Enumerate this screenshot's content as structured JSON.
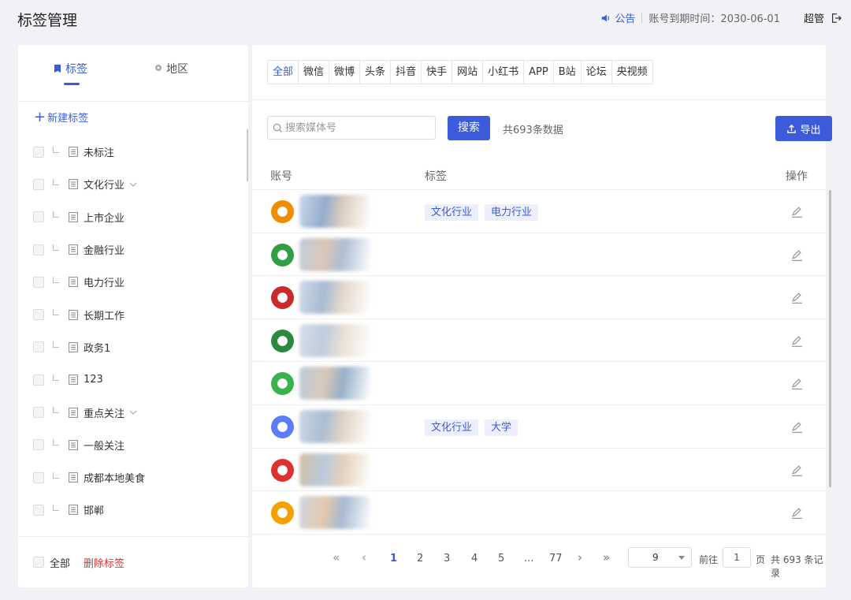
{
  "header": {
    "title": "标签管理",
    "notice": "公告",
    "expire": "账号到期时间：2030-06-01",
    "user": "超管"
  },
  "left": {
    "tabs": [
      {
        "label": "标签",
        "active": true
      },
      {
        "label": "地区",
        "active": false
      }
    ],
    "new_tag": "新建标签",
    "tags": [
      {
        "label": "未标注",
        "expandable": false
      },
      {
        "label": "文化行业",
        "expandable": true
      },
      {
        "label": "上市企业",
        "expandable": false
      },
      {
        "label": "金融行业",
        "expandable": false
      },
      {
        "label": "电力行业",
        "expandable": false
      },
      {
        "label": "长期工作",
        "expandable": false
      },
      {
        "label": "政务1",
        "expandable": false
      },
      {
        "label": "123",
        "expandable": false
      },
      {
        "label": "重点关注",
        "expandable": true
      },
      {
        "label": "一般关注",
        "expandable": false
      },
      {
        "label": "成都本地美食",
        "expandable": false
      },
      {
        "label": "邯郸",
        "expandable": false
      }
    ],
    "footer": {
      "select_all": "全部",
      "delete": "删除标签"
    }
  },
  "right": {
    "platforms": [
      "全部",
      "微信",
      "微博",
      "头条",
      "抖音",
      "快手",
      "网站",
      "小红书",
      "APP",
      "B站",
      "论坛",
      "央视频"
    ],
    "active_platform": "全部",
    "search": {
      "placeholder": "搜索媒体号",
      "button": "搜索"
    },
    "total": "共693条数据",
    "export": "导出",
    "columns": {
      "account": "账号",
      "tags": "标签",
      "action": "操作"
    },
    "rows": [
      {
        "avatar_color": "#f08c00",
        "tags": [
          "文化行业",
          "电力行业"
        ]
      },
      {
        "avatar_color": "#2f9e44",
        "tags": []
      },
      {
        "avatar_color": "#c92a2a",
        "tags": []
      },
      {
        "avatar_color": "#2b8a3e",
        "tags": []
      },
      {
        "avatar_color": "#37b24d",
        "tags": []
      },
      {
        "avatar_color": "#5c7cfa",
        "tags": [
          "文化行业",
          "大学"
        ]
      },
      {
        "avatar_color": "#e03131",
        "tags": []
      },
      {
        "avatar_color": "#f59f00",
        "tags": []
      }
    ],
    "pagination": {
      "pages": [
        "1",
        "2",
        "3",
        "4",
        "5",
        "...",
        "77"
      ],
      "current": "1",
      "page_size": "9",
      "goto_label": "前往",
      "goto_value": "1",
      "page_unit": "页",
      "total_records": "共 693 条记录"
    }
  },
  "colors": {
    "accent": "#3b5bdb",
    "danger": "#e03131"
  }
}
